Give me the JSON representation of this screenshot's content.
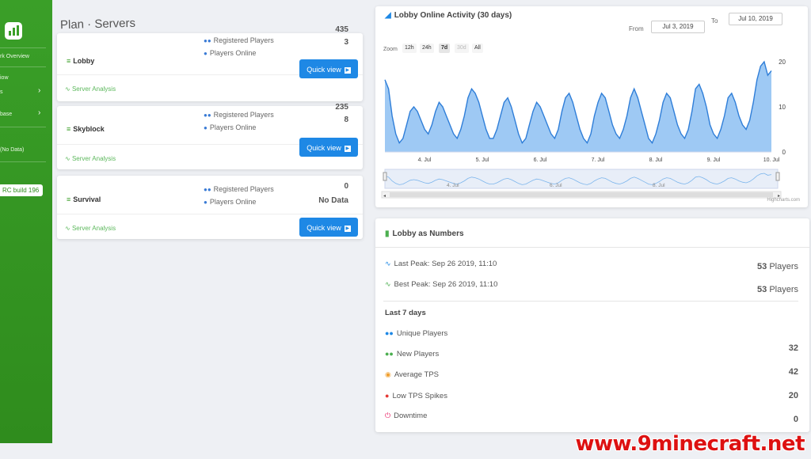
{
  "sidebar": {
    "items": [
      {
        "label": "rk Overview",
        "chevron": false
      },
      {
        "label": "iow",
        "chevron": false
      },
      {
        "label": "s",
        "chevron": true
      },
      {
        "label": "base",
        "chevron": true
      },
      {
        "label": "(No Data)",
        "chevron": false
      }
    ],
    "version": "RC build 196"
  },
  "page_title": "Plan · Servers",
  "servers": [
    {
      "name": "Lobby",
      "registered_label": "Registered Players",
      "online_label": "Players Online",
      "registered": "435",
      "online": "3",
      "link": "Server Analysis",
      "button": "Quick view"
    },
    {
      "name": "Skyblock",
      "registered_label": "Registered Players",
      "online_label": "Players Online",
      "registered": "235",
      "online": "8",
      "link": "Server Analysis",
      "button": "Quick view"
    },
    {
      "name": "Survival",
      "registered_label": "Registered Players",
      "online_label": "Players Online",
      "registered": "0",
      "online": "No Data",
      "link": "Server Analysis",
      "button": "Quick view"
    }
  ],
  "activity": {
    "title": "Lobby Online Activity (30 days)",
    "from_label": "From",
    "from_value": "Jul 3, 2019",
    "to_label": "To",
    "to_value": "Jul 10, 2019",
    "zoom_label": "Zoom",
    "zoom_buttons": [
      {
        "label": "12h",
        "state": "normal"
      },
      {
        "label": "24h",
        "state": "normal"
      },
      {
        "label": "7d",
        "state": "active"
      },
      {
        "label": "30d",
        "state": "disabled"
      },
      {
        "label": "All",
        "state": "normal"
      }
    ],
    "credits": "Highcharts.com",
    "navigator_labels": [
      "4. Jul",
      "6. Jul",
      "8. Jul"
    ]
  },
  "chart_data": {
    "type": "area",
    "x": [
      "4. Jul",
      "5. Jul",
      "6. Jul",
      "7. Jul",
      "8. Jul",
      "9. Jul",
      "10. Jul"
    ],
    "y_ticks": [
      "0",
      "10",
      "20"
    ],
    "ylim": [
      0,
      20
    ],
    "color": "#9ec9f4",
    "line_color": "#2f7ed8",
    "values": [
      16,
      14,
      8,
      4,
      2,
      3,
      6,
      9,
      10,
      9,
      7,
      5,
      4,
      6,
      9,
      11,
      10,
      8,
      6,
      4,
      3,
      5,
      8,
      12,
      14,
      13,
      11,
      8,
      5,
      3,
      3,
      5,
      8,
      11,
      12,
      10,
      7,
      4,
      2,
      3,
      6,
      9,
      11,
      10,
      8,
      6,
      4,
      3,
      5,
      9,
      12,
      13,
      11,
      8,
      5,
      3,
      2,
      4,
      8,
      11,
      13,
      12,
      9,
      6,
      4,
      3,
      5,
      8,
      12,
      14,
      12,
      9,
      6,
      3,
      2,
      4,
      7,
      11,
      13,
      12,
      9,
      6,
      4,
      3,
      5,
      9,
      14,
      15,
      13,
      10,
      6,
      4,
      3,
      5,
      8,
      12,
      13,
      11,
      8,
      6,
      5,
      7,
      11,
      16,
      19,
      20,
      17,
      18
    ]
  },
  "numbers": {
    "title": "Lobby as Numbers",
    "last_peak_label": "Last Peak: Sep 26 2019, 11:10",
    "last_peak_value": "53",
    "best_peak_label": "Best Peak: Sep 26 2019, 11:10",
    "best_peak_value": "53",
    "players_unit": "Players",
    "section": "Last 7 days",
    "rows": [
      {
        "label": "Unique Players",
        "value": "",
        "icon_color": "#1e88e5"
      },
      {
        "label": "New Players",
        "value": "32",
        "icon_color": "#4caf50"
      },
      {
        "label": "Average TPS",
        "value": "42",
        "icon_color": "#f0a030"
      },
      {
        "label": "Low TPS Spikes",
        "value": "20",
        "icon_color": "#e53935"
      },
      {
        "label": "Downtime",
        "value": "0",
        "icon_color": "#e91e63"
      }
    ]
  },
  "watermark": "www.9minecraft.net"
}
